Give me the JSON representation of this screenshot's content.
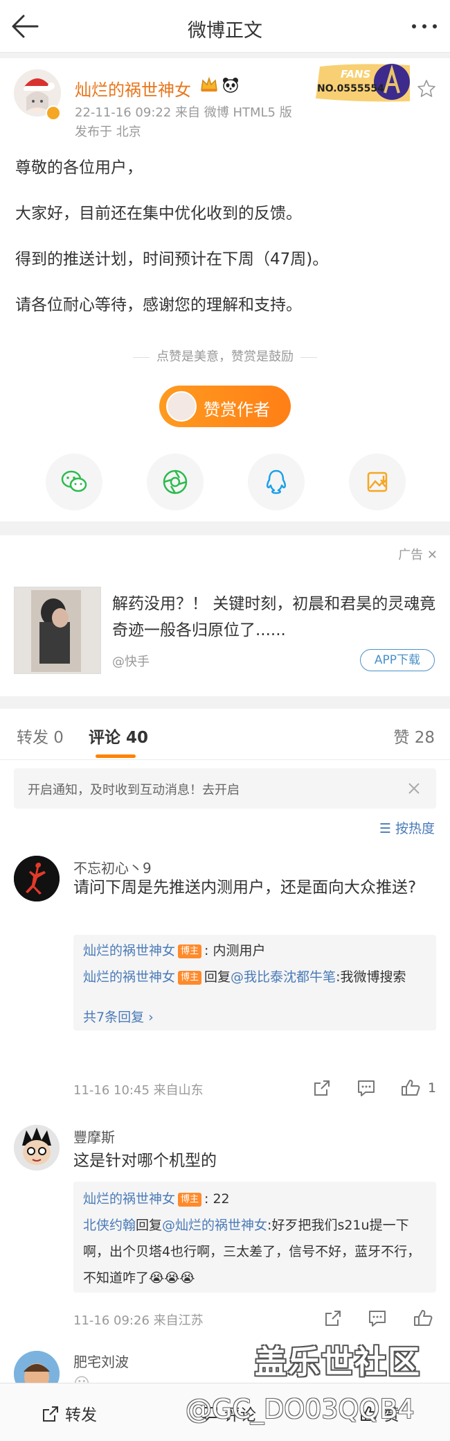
{
  "header": {
    "title": "微博正文"
  },
  "post": {
    "author": "灿烂的祸世神女",
    "fans_label": "FANS",
    "fans_no": "NO.0555554",
    "meta": "22-11-16 09:22  来自 微博 HTML5 版",
    "location": "发布于 北京",
    "paragraphs": [
      "尊敬的各位用户，",
      "大家好，目前还在集中优化收到的反馈。",
      "得到的推送计划，时间预计在下周（47周)。",
      "请各位耐心等待，感谢您的理解和支持。"
    ],
    "appreciate_line": "点赞是美意，赞赏是鼓励",
    "reward_label": "赞赏作者",
    "share_icons": [
      "wechat-icon",
      "moments-icon",
      "qq-icon",
      "save-image-icon"
    ]
  },
  "ad": {
    "tag": "广告",
    "title": "解药没用？！ 关键时刻，初晨和君昊的灵魂竟奇迹一般各归原位了......",
    "source": "@快手",
    "download": "APP下载"
  },
  "tabs": {
    "repost": "转发 0",
    "comment": "评论 40",
    "like": "赞 28"
  },
  "notify": {
    "text": "开启通知，及时收到互动消息！去开启"
  },
  "sort": {
    "label": "按热度"
  },
  "comments": [
    {
      "name": "不忘初心丶9",
      "text": "请问下周是先推送内测用户，还是面向大众推送?",
      "replies": [
        {
          "name": "灿烂的祸世神女",
          "tag": "博主",
          "body": ": 内测用户"
        },
        {
          "name": "灿烂的祸世神女",
          "tag": "博主",
          "mid": "回复",
          "mention": "@我比泰沈都牛笔",
          "body": ":我微博搜索"
        }
      ],
      "more": "共7条回复 ›",
      "meta": "11-16 10:45  来自山东",
      "likes": "1"
    },
    {
      "name": "豐摩斯",
      "text": "这是针对哪个机型的",
      "replies": [
        {
          "name": "灿烂的祸世神女",
          "tag": "博主",
          "body": ": 22"
        },
        {
          "name": "北侠约翰",
          "mid": "回复",
          "mention": "@灿烂的祸世神女",
          "body": ":好歹把我们s21u提一下啊，出个贝塔4也行啊，三太差了，信号不好，蓝牙不行，不知道咋了😭😭😭"
        }
      ],
      "meta": "11-16 09:26  来自江苏"
    },
    {
      "name": "肥宅刘波",
      "text": "😀 ..."
    }
  ],
  "bottom": {
    "repost": "转发",
    "comment": "评论",
    "like": "赞"
  },
  "watermark": {
    "title": "盖乐世社区",
    "user": "@GC_DO03QQB4"
  }
}
